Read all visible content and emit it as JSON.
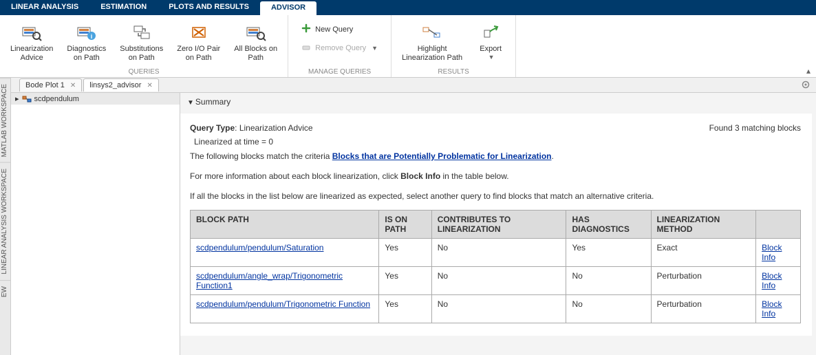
{
  "top_tabs": [
    {
      "label": "LINEAR ANALYSIS"
    },
    {
      "label": "ESTIMATION"
    },
    {
      "label": "PLOTS AND RESULTS"
    },
    {
      "label": "ADVISOR",
      "active": true
    }
  ],
  "ribbon": {
    "queries": {
      "label": "QUERIES",
      "items": [
        {
          "label": "Linearization\nAdvice"
        },
        {
          "label": "Diagnostics\non Path"
        },
        {
          "label": "Substitutions\non Path"
        },
        {
          "label": "Zero I/O Pair\non Path"
        },
        {
          "label": "All Blocks on\nPath"
        }
      ]
    },
    "manage": {
      "label": "MANAGE QUERIES",
      "new_query": "New Query",
      "remove_query": "Remove Query"
    },
    "results": {
      "label": "RESULTS",
      "highlight": "Highlight\nLinearization Path",
      "export": "Export"
    }
  },
  "side_tabs": [
    "MATLAB WORKSPACE",
    "LINEAR ANALYSIS WORKSPACE",
    "EW"
  ],
  "doc_tabs": [
    {
      "label": "Bode Plot 1"
    },
    {
      "label": "linsys2_advisor",
      "active": true
    }
  ],
  "tree": {
    "root": "scdpendulum"
  },
  "summary": {
    "heading": "Summary",
    "query_type_label": "Query Type",
    "query_type_value": "Linearization Advice",
    "found_text": "Found 3 matching blocks",
    "linearized": "Linearized at time = 0",
    "para1_pre": "The following blocks match the criteria ",
    "para1_link": "Blocks that are Potentially Problematic for Linearization",
    "para2_pre": "For more information about each block linearization, click ",
    "para2_bold": "Block Info",
    "para2_post": " in the table below.",
    "para3": "If all the blocks in the list below are linearized as expected, select another query to find blocks that match an alternative criteria."
  },
  "table": {
    "headers": [
      "BLOCK PATH",
      "IS ON PATH",
      "CONTRIBUTES TO LINEARIZATION",
      "HAS DIAGNOSTICS",
      "LINEARIZATION METHOD",
      ""
    ],
    "rows": [
      {
        "path": "scdpendulum/pendulum/Saturation",
        "on_path": "Yes",
        "contrib": "No",
        "diag": "Yes",
        "method": "Exact",
        "info": "Block Info"
      },
      {
        "path": "scdpendulum/angle_wrap/Trigonometric Function1",
        "on_path": "Yes",
        "contrib": "No",
        "diag": "No",
        "method": "Perturbation",
        "info": "Block Info"
      },
      {
        "path": "scdpendulum/pendulum/Trigonometric Function",
        "on_path": "Yes",
        "contrib": "No",
        "diag": "No",
        "method": "Perturbation",
        "info": "Block Info"
      }
    ]
  }
}
